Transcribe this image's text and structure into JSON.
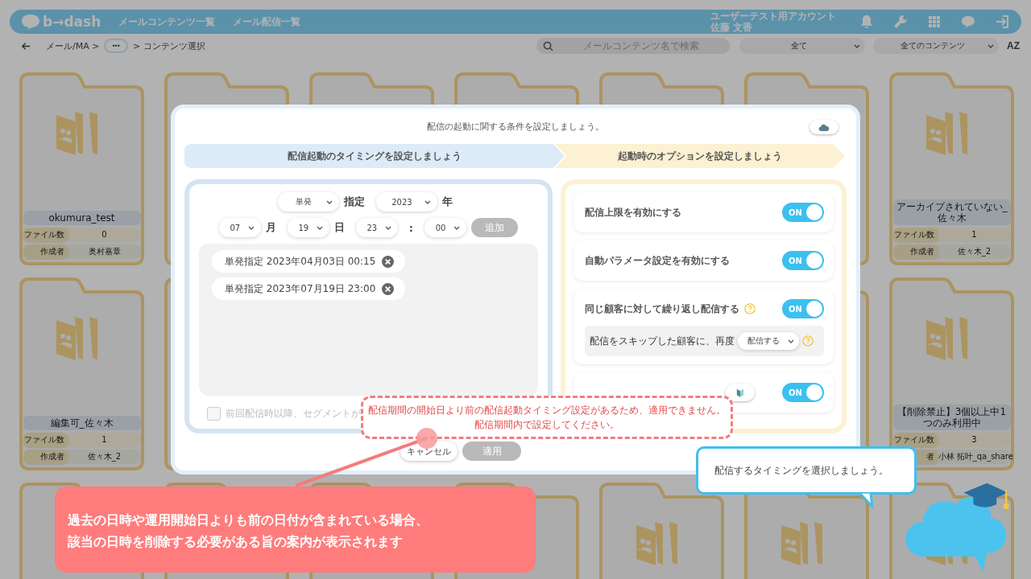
{
  "header": {
    "logo": "b→dash",
    "nav": [
      "メールコンテンツ一覧",
      "メール配信一覧"
    ],
    "account": "ユーザーテスト用アカウント",
    "user": "佐藤 文香"
  },
  "subbar": {
    "root": "メール/MA >",
    "ellipsis": "•••",
    "current": "> コンテンツ選択",
    "search_placeholder": "メールコンテンツ名で検索",
    "filters": [
      "全て",
      "全てのコンテンツ"
    ],
    "sort": "AZ"
  },
  "folder_rows": [
    [
      {
        "kind": "folder",
        "name": "okumura_test",
        "count_label": "ファイル数",
        "count": "0",
        "creator_label": "作成者",
        "creator": "奥村嘉章"
      },
      {
        "kind": "covered"
      },
      {
        "kind": "covered"
      },
      {
        "kind": "covered"
      },
      {
        "kind": "covered"
      },
      {
        "kind": "covered"
      },
      {
        "kind": "folder",
        "name": "アーカイブされていない_佐々木",
        "count_label": "ファイル数",
        "count": "1",
        "creator_label": "作成者",
        "creator": "佐々木_2"
      }
    ],
    [
      {
        "kind": "folder",
        "name": "編集可_佐々木",
        "count_label": "ファイル数",
        "count": "1",
        "creator_label": "作成者",
        "creator": "佐々木_2"
      },
      {
        "kind": "covered"
      },
      {
        "kind": "hidden"
      },
      {
        "kind": "hidden"
      },
      {
        "kind": "hidden"
      },
      {
        "kind": "covered"
      },
      {
        "kind": "folder",
        "name": "【削除禁止】3個以上中1つのみ利用中",
        "count_label": "ファイル数",
        "count": "3",
        "creator_label": "者",
        "creator": "小林 拓叶_qa_share"
      }
    ],
    [
      {
        "kind": "folder"
      },
      {
        "kind": "folder"
      },
      {
        "kind": "folder"
      },
      {
        "kind": "folder"
      },
      {
        "kind": "folder"
      },
      {
        "kind": "folder"
      },
      {
        "kind": "folder"
      }
    ]
  ],
  "dialog": {
    "title": "配信の起動に関する条件を設定しましょう。",
    "steps": [
      {
        "label": "配信起動のタイミングを設定しましょう",
        "color": "#dcebf7"
      },
      {
        "label": "起動時のオプションを設定しましょう",
        "color": "#fcf1d2"
      }
    ],
    "timing": {
      "mode": "単発",
      "mode_suffix": "指定",
      "year": "2023",
      "year_suffix": "年",
      "month": "07",
      "month_suffix": "月",
      "day": "19",
      "day_suffix": "日",
      "hour": "23",
      "separator": ":",
      "minute": "00",
      "add_button": {
        "label": "追加",
        "disabled": true
      },
      "entries": [
        "単発指定 2023年04月03日 00:15",
        "単発指定 2023年07月19日 23:00"
      ],
      "checkbox": {
        "label": "前回配信時以降、セグメントが",
        "checked": false
      }
    },
    "options": [
      {
        "kind": "toggle",
        "label": "配信上限を有効にする",
        "help": false,
        "beginner_badge": false,
        "on": true,
        "toggle_label": "ON"
      },
      {
        "kind": "toggle",
        "label": "自動パラメータ設定を有効にする",
        "help": false,
        "beginner_badge": false,
        "on": true,
        "toggle_label": "ON"
      },
      {
        "kind": "toggle",
        "label": "同じ顧客に対して繰り返し配信する",
        "help": true,
        "beginner_badge": false,
        "on": true,
        "toggle_label": "ON",
        "sub": {
          "label": "配信をスキップした顧客に、再度",
          "value": "配信する",
          "help": true
        }
      },
      {
        "kind": "toggle",
        "help": false,
        "beginner_badge": true,
        "on": true,
        "toggle_label": "ON"
      }
    ],
    "buttons": [
      {
        "label": "キャンセル",
        "disabled": false
      },
      {
        "label": "適用",
        "disabled": true
      }
    ]
  },
  "error_callout": {
    "lines": [
      "配信期間の開始日より前の配信起動タイミング設定があるため、適用できません。",
      "配信期間内で設定してください。"
    ]
  },
  "annotation": {
    "lines": [
      "過去の日時や運用開始日よりも前の日付が含まれている場合、",
      "該当の日時を削除する必要がある旨の案内が表示されます"
    ]
  },
  "tooltip": {
    "text": "配信するタイミングを選択しましょう。"
  }
}
